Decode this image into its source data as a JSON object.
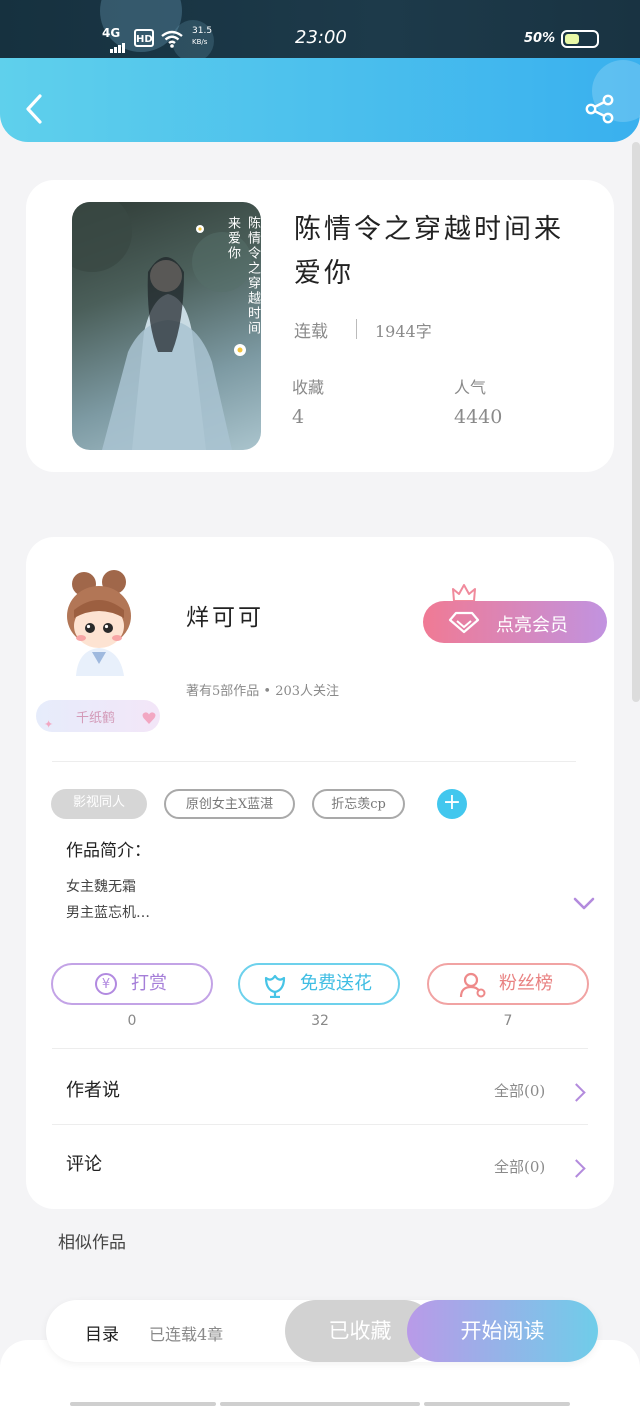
{
  "status_bar": {
    "network": "4G",
    "hd": "HD",
    "speed_value": "31.5",
    "speed_unit": "KB/s",
    "time": "23:00",
    "battery_percent": "50%",
    "battery_level": 0.5
  },
  "book": {
    "cover_text": "陈情令之穿越时间来爱你",
    "title": "陈情令之穿越时间来爱你",
    "status": "连载",
    "word_count": "1944字",
    "stats": [
      {
        "label": "收藏",
        "value": "4"
      },
      {
        "label": "人气",
        "value": "4440"
      }
    ]
  },
  "author": {
    "name": "烊可可",
    "badge": "千纸鹤",
    "meta": "著有5部作品 • 203人关注",
    "vip_button": "点亮会员"
  },
  "tags": [
    "影视同人",
    "原创女主X蓝湛",
    "折忘羡cp"
  ],
  "intro": {
    "heading": "作品简介：",
    "line1": "女主魏无霜",
    "line2": "男主蓝忘机…"
  },
  "actions": [
    {
      "label": "打赏",
      "count": "0",
      "icon": "yen-coin-icon",
      "color": "#b28ae0"
    },
    {
      "label": "免费送花",
      "count": "32",
      "icon": "flower-icon",
      "color": "#47c4e6"
    },
    {
      "label": "粉丝榜",
      "count": "7",
      "icon": "person-icon",
      "color": "#ee8a8a"
    }
  ],
  "rows": [
    {
      "label": "作者说",
      "right": "全部(0)"
    },
    {
      "label": "评论",
      "right": "全部(0)"
    }
  ],
  "similar_heading": "相似作品",
  "bottom": {
    "catalog": "目录",
    "progress": "已连载4章",
    "collected": "已收藏",
    "start": "开始阅读"
  }
}
